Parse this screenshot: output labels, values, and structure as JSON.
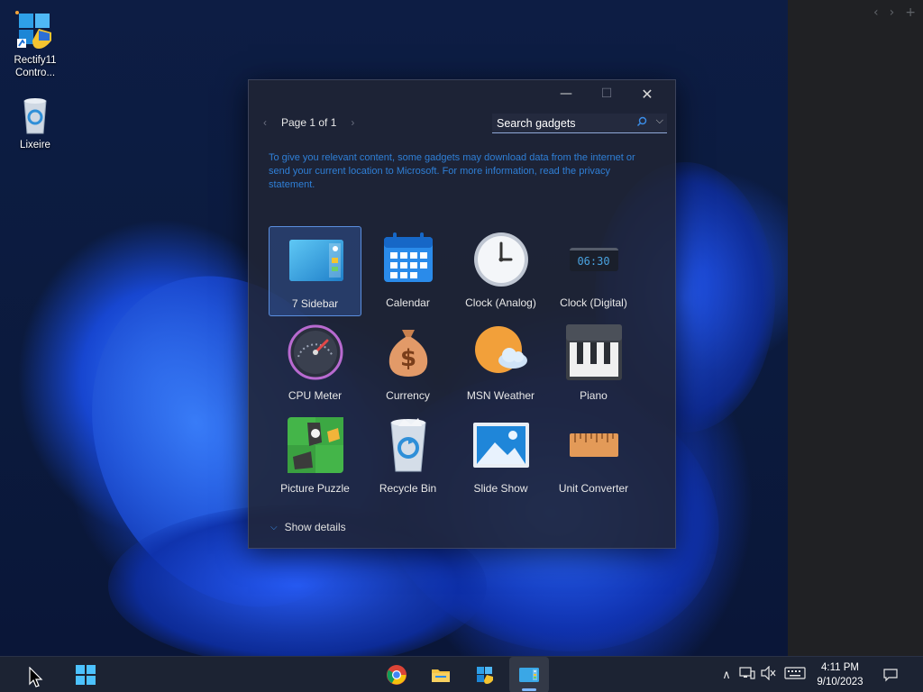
{
  "desktop": {
    "icons": [
      {
        "label": "Rectify11 Contro...",
        "icon": "control-panel-icon"
      },
      {
        "label": "Lixeire",
        "icon": "recycle-bin-icon"
      }
    ]
  },
  "side_panel": {
    "nav": [
      "‹",
      "›",
      "+"
    ]
  },
  "gadget_window": {
    "controls": {
      "minimize": "—",
      "maximize": "☐",
      "close": "✕"
    },
    "pager": {
      "prev": "‹",
      "label": "Page 1 of 1",
      "next": "›"
    },
    "search": {
      "placeholder": "Search gadgets",
      "icon": "search-icon",
      "dropdown": "⌵"
    },
    "privacy_text": "To give you relevant content, some gadgets may download data from the internet or send your current location to Microsoft. For more information, read the privacy statement.",
    "gadgets": [
      {
        "label": "7 Sidebar",
        "icon": "sidebar-icon",
        "selected": true
      },
      {
        "label": "Calendar",
        "icon": "calendar-icon",
        "selected": false
      },
      {
        "label": "Clock (Analog)",
        "icon": "analog-clock-icon",
        "selected": false
      },
      {
        "label": "Clock (Digital)",
        "icon": "digital-clock-icon",
        "selected": false,
        "display": "06:30"
      },
      {
        "label": "CPU Meter",
        "icon": "cpu-meter-icon",
        "selected": false
      },
      {
        "label": "Currency",
        "icon": "currency-icon",
        "selected": false
      },
      {
        "label": "MSN Weather",
        "icon": "weather-icon",
        "selected": false
      },
      {
        "label": "Piano",
        "icon": "piano-icon",
        "selected": false
      },
      {
        "label": "Picture Puzzle",
        "icon": "puzzle-icon",
        "selected": false
      },
      {
        "label": "Recycle Bin",
        "icon": "recycle-bin-icon",
        "selected": false
      },
      {
        "label": "Slide Show",
        "icon": "slideshow-icon",
        "selected": false
      },
      {
        "label": "Unit Converter",
        "icon": "ruler-icon",
        "selected": false
      }
    ],
    "details": {
      "chevron": "⌵",
      "label": "Show details"
    }
  },
  "taskbar": {
    "apps": [
      "start-icon",
      "chrome-icon",
      "file-explorer-icon",
      "control-panel-icon",
      "gadgets-icon"
    ],
    "tray": {
      "chevron": "∧"
    },
    "clock": {
      "time": "4:11 PM",
      "date": "9/10/2023"
    }
  },
  "colors": {
    "accent": "#3b8eea",
    "window_bg": "#202434",
    "taskbar_bg": "#1c2333",
    "link": "#2f7fd6"
  }
}
